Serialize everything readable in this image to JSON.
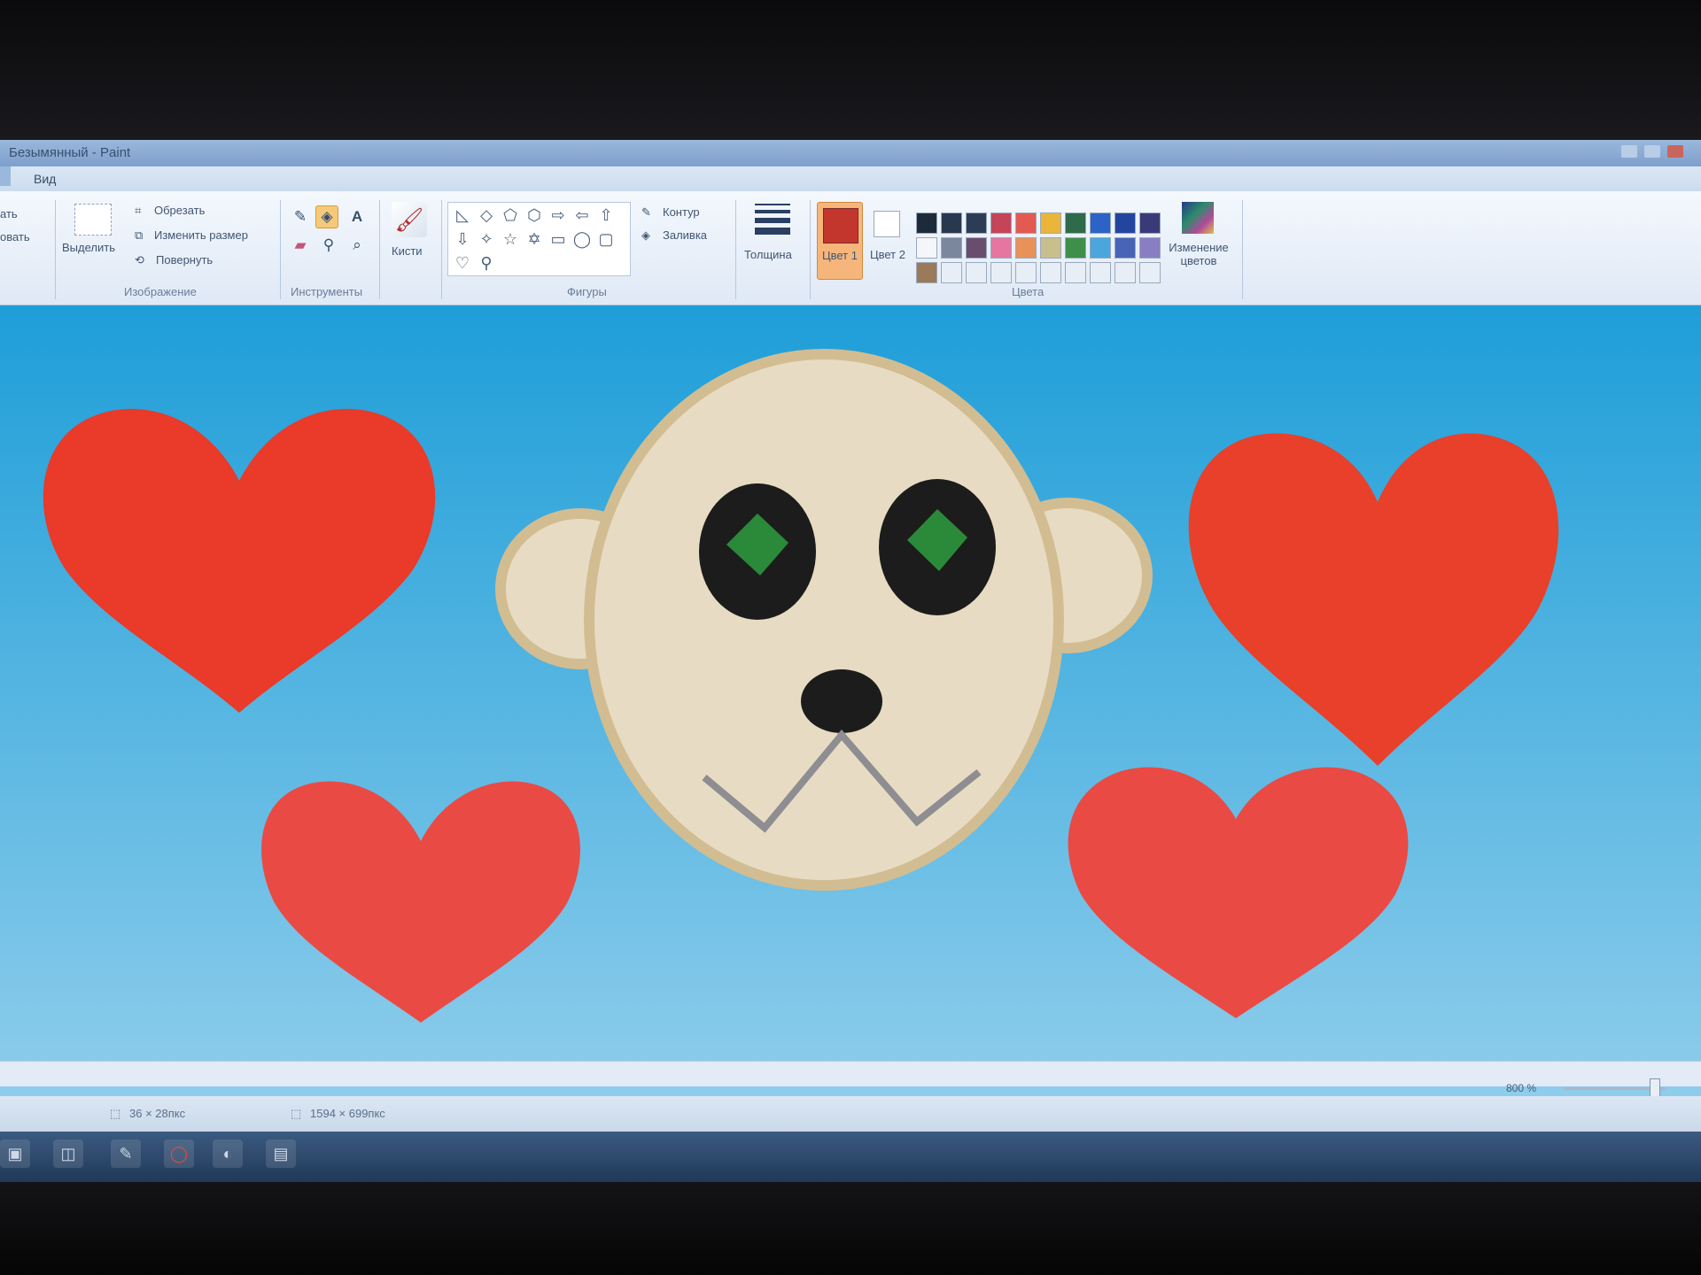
{
  "window": {
    "title": "Безымянный - Paint"
  },
  "tabs": [
    {
      "label": "Вид"
    }
  ],
  "ribbon": {
    "clipboard": {
      "paste_label": "ать",
      "copy_label": "овать"
    },
    "image": {
      "group_label": "Изображение",
      "select_label": "Выделить",
      "crop_label": "Обрезать",
      "resize_label": "Изменить размер",
      "rotate_label": "Повернуть"
    },
    "tools": {
      "group_label": "Инструменты",
      "items": [
        "pencil-icon",
        "fill-icon",
        "text-icon",
        "eraser-icon",
        "color-picker-icon",
        "magnifier-icon"
      ],
      "active": "fill-icon"
    },
    "brushes": {
      "label": "Кисти"
    },
    "shapes": {
      "group_label": "Фигуры",
      "outline_label": "Контур",
      "fill_label": "Заливка",
      "items": [
        "◺",
        "◇",
        "⬠",
        "⬡",
        "⇨",
        "⇦",
        "⇧",
        "⇩",
        "✧",
        "☆",
        "✡",
        "▭",
        "◯",
        "▢",
        "♡",
        "⚲"
      ]
    },
    "size": {
      "label": "Толщина"
    },
    "colors": {
      "group_label": "Цвета",
      "color1_label": "Цвет 1",
      "color2_label": "Цвет 2",
      "color1": "#c3362e",
      "color2": "#ffffff",
      "edit_label": "Изменение цветов",
      "palette_row1": [
        "#1d2a3a",
        "#27384f",
        "#2d3c55",
        "#c6445a",
        "#e25a52",
        "#e9b63a",
        "#2f6a4b",
        "#2d63c6",
        "#24459e",
        "#3b3a78"
      ],
      "palette_row2": [
        "#f4f6f9",
        "#7a879c",
        "#6a4d6c",
        "#e476a0",
        "#e8925a",
        "#c9bf8d",
        "#3d8f49",
        "#4aa6dd",
        "#4764b6",
        "#8a7ec2"
      ],
      "palette_row3": [
        "#9b7a5a",
        "#e8eef6",
        "#e8eef6",
        "#e8eef6",
        "#e8eef6",
        "#e8eef6",
        "#e8eef6",
        "#e8eef6",
        "#e8eef6",
        "#e8eef6"
      ]
    }
  },
  "status": {
    "cursor_size": "36 × 28пкс",
    "image_size": "1594 × 699пкс",
    "zoom": "800 %"
  },
  "drawing": {
    "background": [
      "#1e9ed8",
      "#9fd4ee"
    ],
    "heart_colors": [
      "#e93a2a",
      "#e8402a",
      "#ea4a44",
      "#e94a44"
    ],
    "face_fill": "#e7dcc3",
    "face_outline": "#d2bd92",
    "eye_color": "#1c1c1c",
    "iris_color": "#2a8a3a",
    "nose_color": "#1c1c1c",
    "mouth_color": "#8d8d92"
  }
}
